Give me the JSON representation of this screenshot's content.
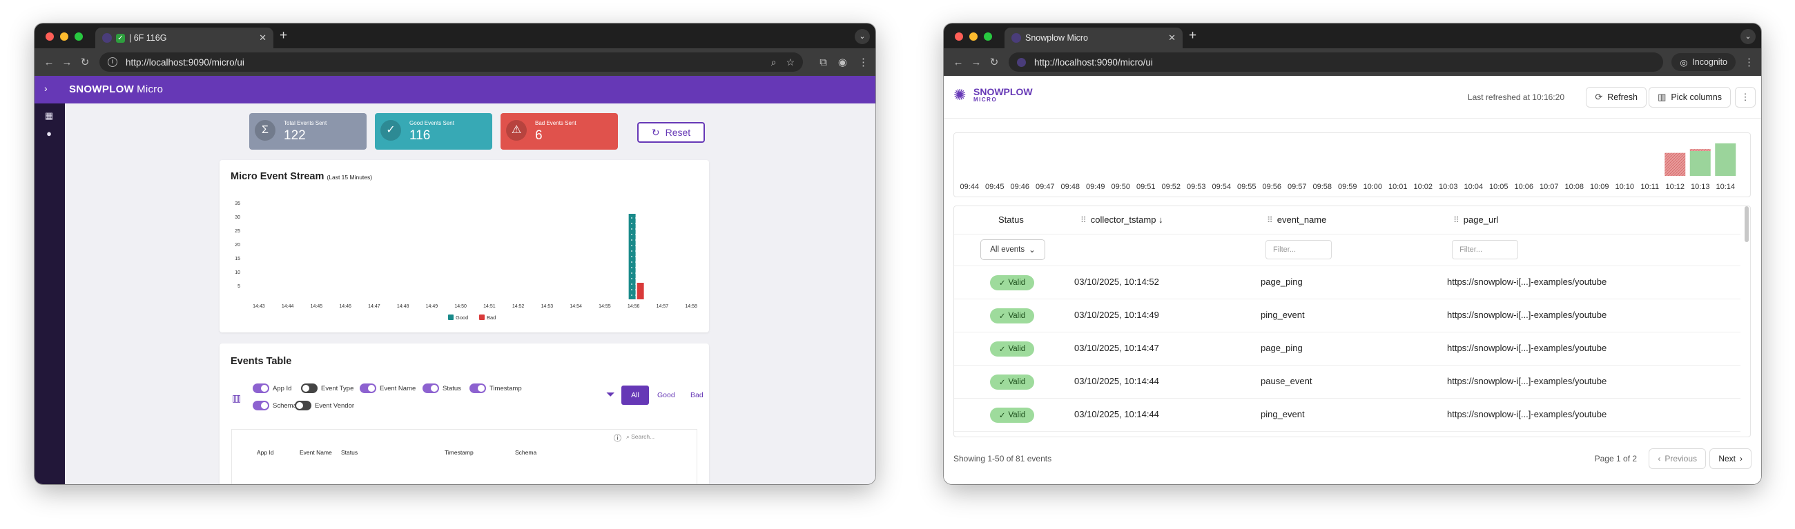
{
  "left_window": {
    "tab_title": "| 6F 116G",
    "url": "http://localhost:9090/micro/ui",
    "brand": "SNOWPLOW",
    "brand_suffix": "Micro",
    "stats": [
      {
        "label": "Total Events Sent",
        "value": "122",
        "color": "#8c96ab",
        "icon": "sigma-icon"
      },
      {
        "label": "Good Events Sent",
        "value": "116",
        "color": "#37a9b5",
        "icon": "check-circle-icon"
      },
      {
        "label": "Bad Events Sent",
        "value": "6",
        "color": "#e0524c",
        "icon": "warning-icon"
      }
    ],
    "reset_label": "Reset",
    "chart_title": "Micro Event Stream",
    "chart_subtitle": "(Last 15 Minutes)",
    "table_title": "Events Table",
    "toggles": [
      {
        "label": "App Id",
        "on": true
      },
      {
        "label": "Event Type",
        "on": false
      },
      {
        "label": "Event Name",
        "on": true
      },
      {
        "label": "Status",
        "on": true
      },
      {
        "label": "Timestamp",
        "on": true
      },
      {
        "label": "Schema",
        "on": true
      },
      {
        "label": "Event Vendor",
        "on": false
      }
    ],
    "filters": {
      "all": "All",
      "good": "Good",
      "bad": "Bad"
    },
    "search_placeholder": "Search...",
    "columns": [
      "App Id",
      "Event Name",
      "Status",
      "Timestamp",
      "Schema"
    ]
  },
  "chart_data": [
    {
      "type": "bar",
      "title": "Micro Event Stream",
      "subtitle": "(Last 15 Minutes)",
      "categories": [
        "14:43",
        "14:44",
        "14:45",
        "14:46",
        "14:47",
        "14:48",
        "14:49",
        "14:50",
        "14:51",
        "14:52",
        "14:53",
        "14:54",
        "14:55",
        "14:56",
        "14:57",
        "14:58"
      ],
      "series": [
        {
          "name": "Good",
          "color": "#1a8a8a",
          "values": [
            0,
            0,
            0,
            0,
            0,
            0,
            0,
            0,
            0,
            0,
            0,
            0,
            0,
            31,
            0,
            0
          ]
        },
        {
          "name": "Bad",
          "color": "#d93a3a",
          "values": [
            0,
            0,
            0,
            0,
            0,
            0,
            0,
            0,
            0,
            0,
            0,
            0,
            0,
            6,
            0,
            0
          ]
        }
      ],
      "yticks": [
        5,
        10,
        15,
        20,
        25,
        30,
        35
      ],
      "ylim": [
        0,
        35
      ],
      "legend": "bottom-center"
    },
    {
      "type": "bar",
      "categories": [
        "09:44",
        "09:45",
        "09:46",
        "09:47",
        "09:48",
        "09:49",
        "09:50",
        "09:51",
        "09:52",
        "09:53",
        "09:54",
        "09:55",
        "09:56",
        "09:57",
        "09:58",
        "09:59",
        "10:00",
        "10:01",
        "10:02",
        "10:03",
        "10:04",
        "10:05",
        "10:06",
        "10:07",
        "10:08",
        "10:09",
        "10:10",
        "10:11",
        "10:12",
        "10:13",
        "10:14"
      ],
      "series": [
        {
          "color": "#9bd49b",
          "values": [
            0,
            0,
            0,
            0,
            0,
            0,
            0,
            0,
            0,
            0,
            0,
            0,
            0,
            0,
            0,
            0,
            0,
            0,
            0,
            0,
            0,
            0,
            0,
            0,
            0,
            0,
            0,
            0,
            0,
            26,
            34
          ]
        },
        {
          "color": "#e89a9a",
          "values": [
            0,
            0,
            0,
            0,
            0,
            0,
            0,
            0,
            0,
            0,
            0,
            0,
            0,
            0,
            0,
            0,
            0,
            0,
            0,
            0,
            0,
            0,
            0,
            0,
            0,
            0,
            0,
            0,
            24,
            2,
            0
          ]
        }
      ],
      "ylim": [
        0,
        36
      ]
    }
  ],
  "right_window": {
    "tab_title": "Snowplow Micro",
    "url": "http://localhost:9090/micro/ui",
    "incognito_label": "Incognito",
    "logo_text": "SNOWPLOW",
    "logo_sub": "MICRO",
    "last_refreshed": "Last refreshed at 10:16:20",
    "refresh_label": "Refresh",
    "pick_columns_label": "Pick columns",
    "headers": {
      "status": "Status",
      "collector_tstamp": "collector_tstamp",
      "event_name": "event_name",
      "page_url": "page_url"
    },
    "status_filter": "All events",
    "filter_placeholder": "Filter...",
    "rows": [
      {
        "status": "Valid",
        "tstamp": "03/10/2025, 10:14:52",
        "event": "page_ping",
        "url": "https://snowplow-i[...]-examples/youtube"
      },
      {
        "status": "Valid",
        "tstamp": "03/10/2025, 10:14:49",
        "event": "ping_event",
        "url": "https://snowplow-i[...]-examples/youtube"
      },
      {
        "status": "Valid",
        "tstamp": "03/10/2025, 10:14:47",
        "event": "page_ping",
        "url": "https://snowplow-i[...]-examples/youtube"
      },
      {
        "status": "Valid",
        "tstamp": "03/10/2025, 10:14:44",
        "event": "pause_event",
        "url": "https://snowplow-i[...]-examples/youtube"
      },
      {
        "status": "Valid",
        "tstamp": "03/10/2025, 10:14:44",
        "event": "ping_event",
        "url": "https://snowplow-i[...]-examples/youtube"
      }
    ],
    "showing": "Showing 1-50 of 81 events",
    "page_info": "Page 1 of 2",
    "previous_label": "Previous",
    "next_label": "Next"
  }
}
